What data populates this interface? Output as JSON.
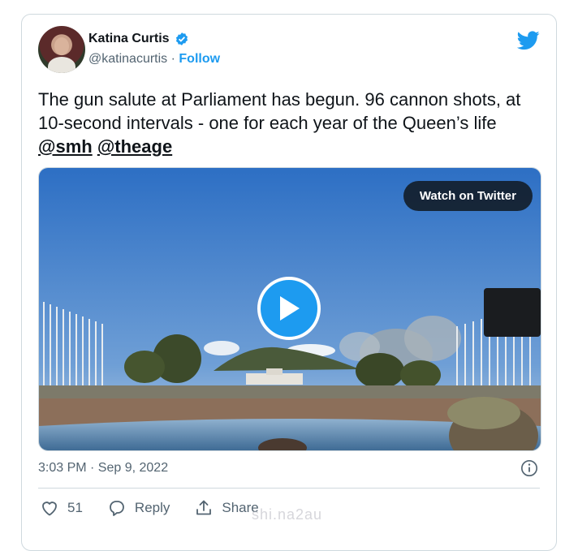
{
  "author": {
    "name": "Katina Curtis",
    "handle": "@katinacurtis",
    "separator": "·",
    "follow_label": "Follow"
  },
  "tweet": {
    "text_main": "The gun salute at Parliament has begun. 96 cannon shots, at 10-second intervals - one for each year of the Queen’s life",
    "mentions": [
      "@smh",
      "@theage"
    ]
  },
  "media": {
    "watch_label": "Watch on Twitter"
  },
  "meta": {
    "timestamp": "3:03 PM · Sep 9, 2022"
  },
  "actions": {
    "likes": "51",
    "reply_label": "Reply",
    "share_label": "Share"
  },
  "watermark": "shi.na2au",
  "colors": {
    "accent": "#1d9bf0",
    "text": "#0f1419",
    "muted": "#536471",
    "border": "#cfd9de"
  },
  "icons": [
    "verified-badge-icon",
    "twitter-bird-icon",
    "play-icon",
    "info-icon",
    "heart-icon",
    "reply-icon",
    "share-icon"
  ]
}
